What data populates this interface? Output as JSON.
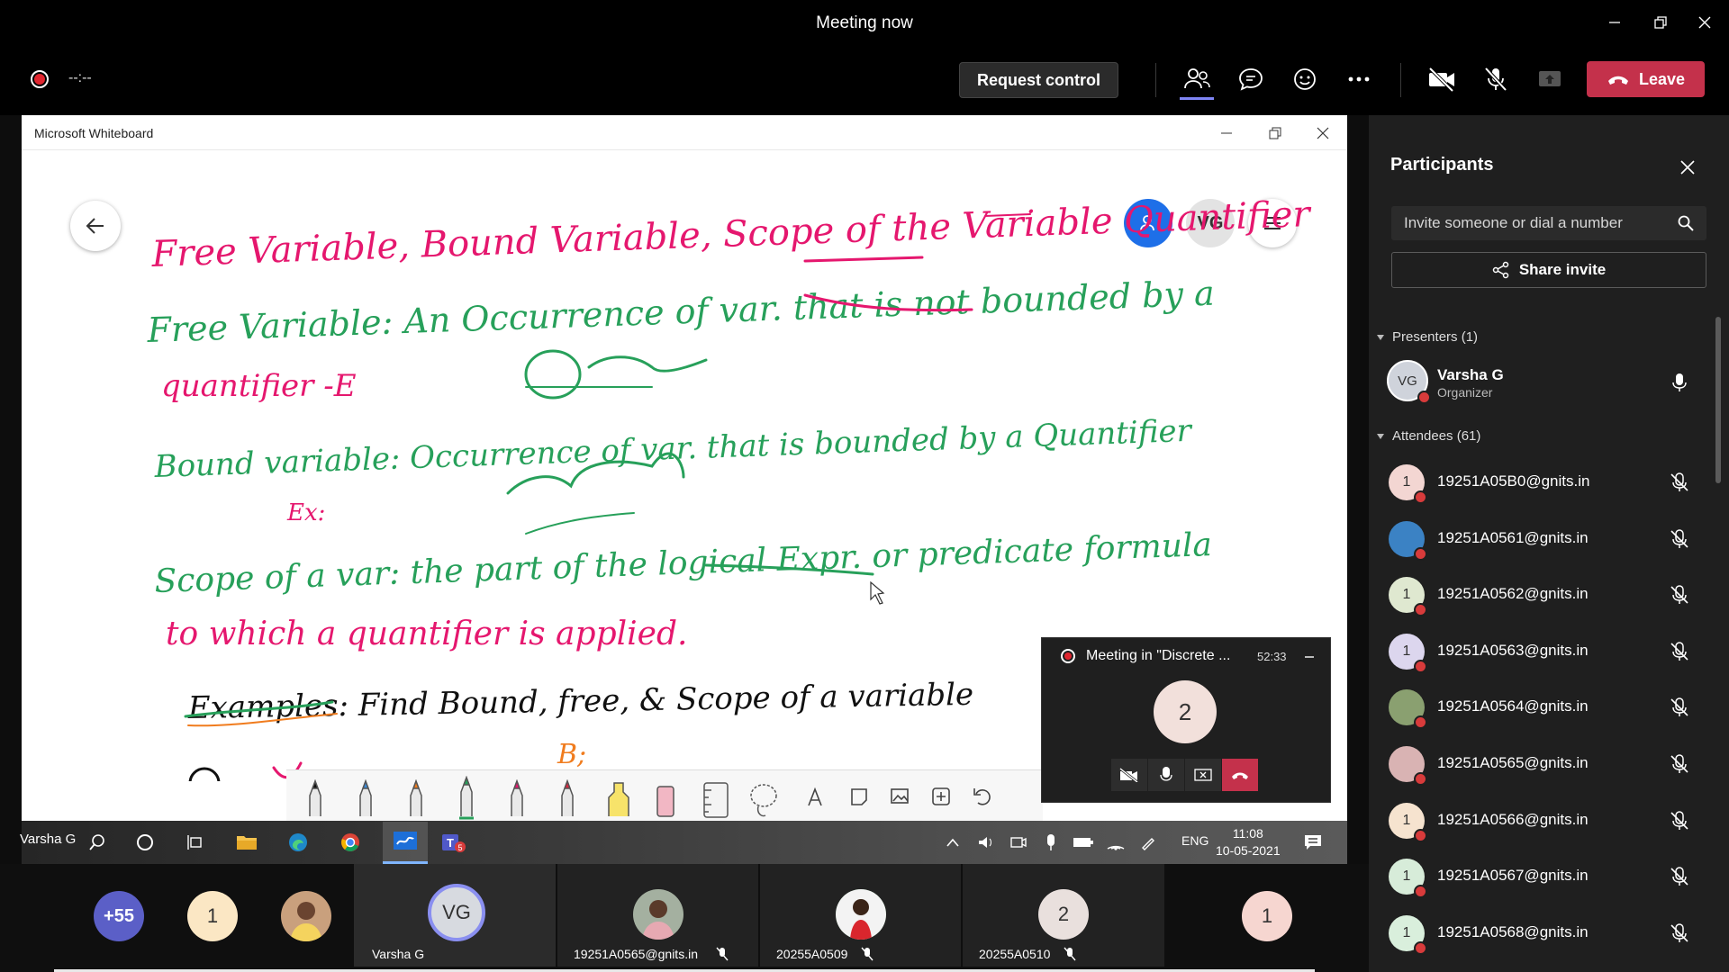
{
  "window": {
    "title": "Meeting now",
    "controls": [
      "minimize-icon",
      "restore-icon",
      "close-icon"
    ]
  },
  "meeting_bar": {
    "timer": "--:--",
    "request_control": "Request control",
    "icons": [
      "participants-icon",
      "chat-icon",
      "reactions-icon",
      "more-icon",
      "camera-off-icon",
      "mic-off-icon",
      "share-tray-icon"
    ],
    "leave": "Leave"
  },
  "whiteboard": {
    "app_title": "Microsoft Whiteboard",
    "avatar": "VG",
    "ink_lines": [
      "Free Variable, Bound Variable, Scope of the Variable Quantifier",
      "Free Variable: An Occurrence of var. that is not bounded by a",
      "quantifier -E",
      "Bound variable: Occurrence of var. that is bounded by a Quantifier",
      "Ex:",
      "Scope of a var: the part of the logical Expr. or predicate formula",
      "to which a quantifier is applied.",
      "Examples: Find Bound, free, & Scope of a variable",
      "B;"
    ],
    "tools": [
      "pen-black",
      "pen-blue",
      "pen-orange",
      "pen-green",
      "pen-pink",
      "pen-red",
      "highlighter-yellow",
      "eraser",
      "ruler",
      "lasso",
      "text",
      "sticky-note",
      "image",
      "add",
      "undo"
    ]
  },
  "taskbar": {
    "user": "Varsha G",
    "lang": "ENG",
    "time": "11:08",
    "date": "10-05-2021"
  },
  "minicall": {
    "title": "Meeting in \"Discrete ...",
    "time": "52:33",
    "avatar": "2"
  },
  "participants": {
    "title": "Participants",
    "invite_placeholder": "Invite someone or dial a number",
    "share_invite": "Share invite",
    "presenters_header": "Presenters (1)",
    "presenter": {
      "initials": "VG",
      "name": "Varsha G",
      "role": "Organizer"
    },
    "attendees_header": "Attendees (61)",
    "attendees": [
      {
        "initial": "1",
        "name": "19251A05B0@gnits.in",
        "color": "#f3d6d2"
      },
      {
        "initial": "",
        "name": "19251A0561@gnits.in",
        "color": "#3b82c4"
      },
      {
        "initial": "1",
        "name": "19251A0562@gnits.in",
        "color": "#dfe8d0"
      },
      {
        "initial": "1",
        "name": "19251A0563@gnits.in",
        "color": "#dcd6ee"
      },
      {
        "initial": "",
        "name": "19251A0564@gnits.in",
        "color": "#8aa070"
      },
      {
        "initial": "",
        "name": "19251A0565@gnits.in",
        "color": "#d9b3b3"
      },
      {
        "initial": "1",
        "name": "19251A0566@gnits.in",
        "color": "#f6e3cf"
      },
      {
        "initial": "1",
        "name": "19251A0567@gnits.in",
        "color": "#d7ecd9"
      },
      {
        "initial": "1",
        "name": "19251A0568@gnits.in",
        "color": "#d9efdc"
      }
    ]
  },
  "gallery": {
    "overflow": "+55",
    "tiles": [
      {
        "initial": "1",
        "label": ""
      },
      {
        "initial": "",
        "label": ""
      },
      {
        "initial": "VG",
        "label": "Varsha G"
      },
      {
        "initial": "",
        "label": "19251A0565@gnits.in"
      },
      {
        "initial": "",
        "label": "20255A0509"
      },
      {
        "initial": "2",
        "label": "20255A0510"
      },
      {
        "initial": "1",
        "label": ""
      }
    ]
  }
}
